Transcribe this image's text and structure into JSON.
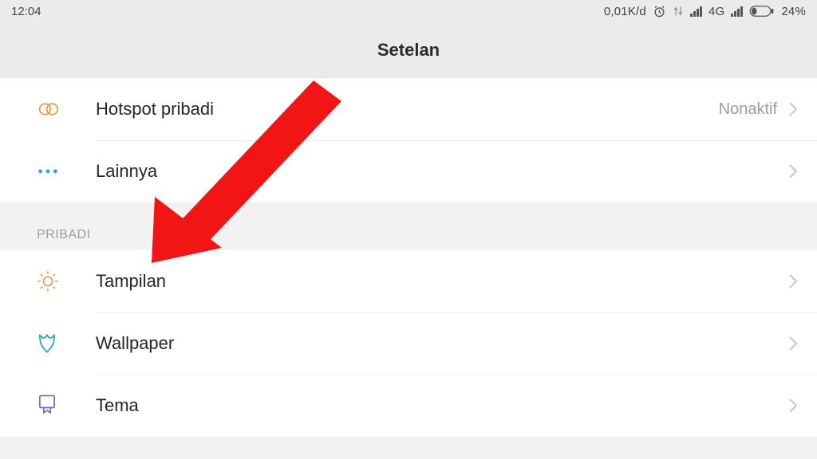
{
  "status": {
    "time": "12:04",
    "data_rate": "0,01K/d",
    "net_label": "4G",
    "battery_pct": "24%"
  },
  "header": {
    "title": "Setelan"
  },
  "group1": {
    "hotspot": {
      "label": "Hotspot pribadi",
      "value": "Nonaktif"
    },
    "more": {
      "label": "Lainnya"
    }
  },
  "section_pribadi": {
    "title": "PRIBADI"
  },
  "group2": {
    "display": {
      "label": "Tampilan"
    },
    "wallpaper": {
      "label": "Wallpaper"
    },
    "theme": {
      "label": "Tema"
    }
  },
  "colors": {
    "accent_orange": "#e39a3c",
    "accent_blue": "#2aa8c9",
    "accent_purple": "#7b6fbf",
    "arrow": "#f31515"
  }
}
